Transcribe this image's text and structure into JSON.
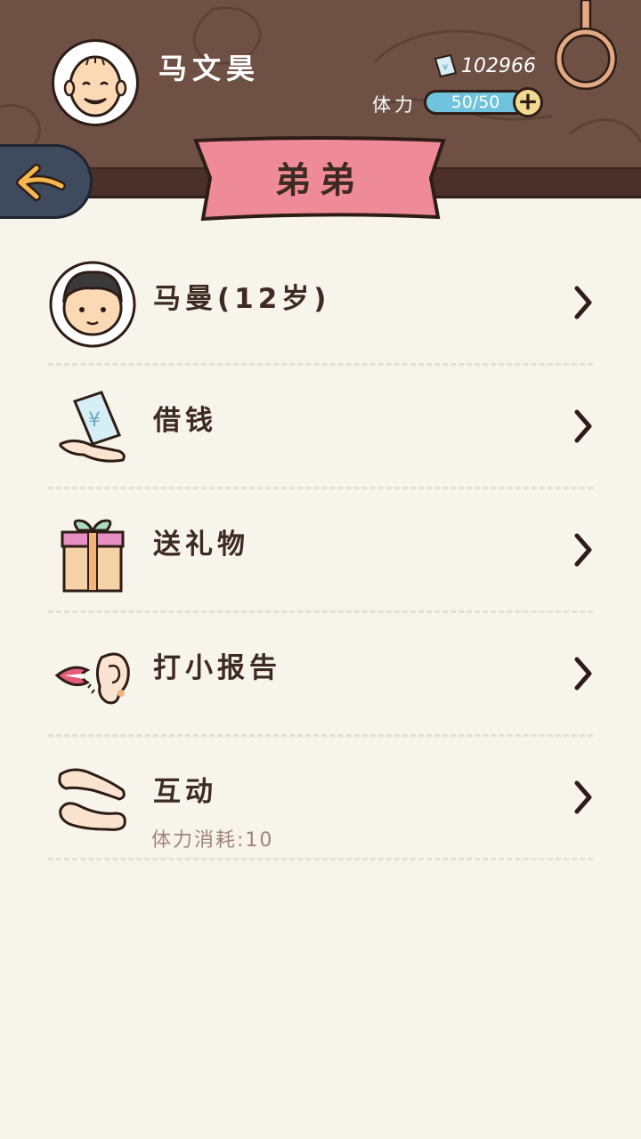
{
  "player": {
    "name": "马文昊",
    "money": "102966"
  },
  "stamina": {
    "label": "体力",
    "value": "50/50",
    "plus": "+"
  },
  "page": {
    "title": "弟弟"
  },
  "list": [
    {
      "label": "马曼(12岁)",
      "icon": "boy-avatar-icon"
    },
    {
      "label": "借钱",
      "icon": "money-hand-icon"
    },
    {
      "label": "送礼物",
      "icon": "gift-icon"
    },
    {
      "label": "打小报告",
      "icon": "whisper-ear-icon"
    },
    {
      "label": "互动",
      "icon": "hands-icon",
      "sub": "体力消耗:10"
    }
  ],
  "colors": {
    "wood": "#6e5044",
    "ribbon": "#ef8a98",
    "stamina": "#6fc3dc",
    "background": "#f7f4ec"
  }
}
